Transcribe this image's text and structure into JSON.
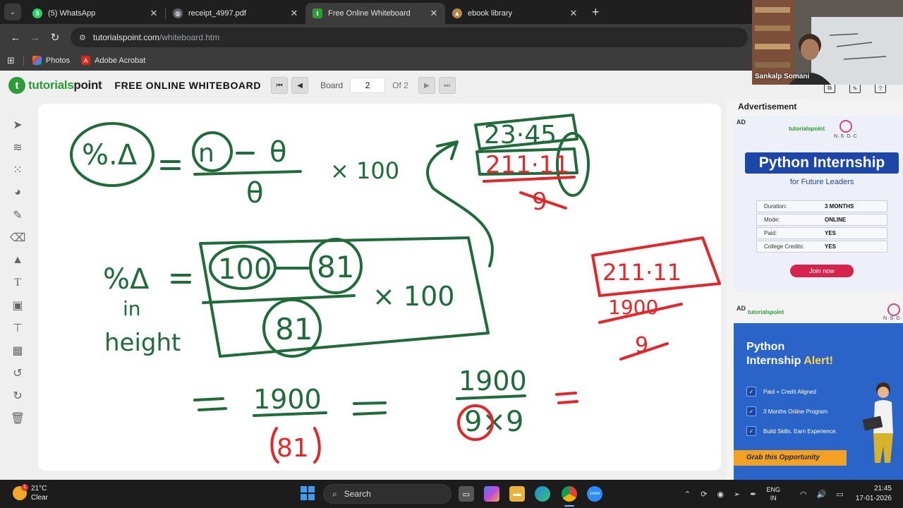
{
  "tabs": [
    {
      "title": "(5) WhatsApp",
      "icon": "whatsapp-icon",
      "color": "#25d366",
      "glyph": "5"
    },
    {
      "title": "receipt_4997.pdf",
      "icon": "globe-icon",
      "color": "#5f6368",
      "glyph": "◍"
    },
    {
      "title": "Free Online Whiteboard",
      "icon": "tutorialspoint-icon",
      "color": "#2c9b38",
      "glyph": "t"
    },
    {
      "title": "ebook library",
      "icon": "book-icon",
      "color": "#b58a45",
      "glyph": "▲"
    }
  ],
  "address": {
    "host": "tutorialspoint.com",
    "path": "/whiteboard.htm"
  },
  "bookmarks": [
    {
      "label": "Photos",
      "icon": "photos-icon"
    },
    {
      "label": "Adobe Acrobat",
      "icon": "acrobat-icon"
    }
  ],
  "site": {
    "logo_part1": "tutorials",
    "logo_part2": "point",
    "title": "FREE ONLINE WHITEBOARD",
    "board_label": "Board",
    "board_value": "2",
    "board_total": "Of 2"
  },
  "ads": {
    "heading": "Advertisement",
    "tag": "AD",
    "brand": "tutorialspoint",
    "nsdc": "N·S·D·C",
    "ad1": {
      "headline": "Python Internship",
      "subline": "for Future Leaders",
      "rows": [
        {
          "k": "Duration:",
          "v": "3 MONTHS"
        },
        {
          "k": "Mode:",
          "v": "ONLINE"
        },
        {
          "k": "Paid:",
          "v": "YES"
        },
        {
          "k": "College Credits:",
          "v": "YES"
        }
      ],
      "button": "Join now"
    },
    "ad2": {
      "headline1": "Python",
      "headline2": "Internship",
      "headline_accent": "Alert!",
      "items": [
        "Paid + Credit Aligned",
        "3 Months Online Program",
        "Build Skills. Earn Experience."
      ],
      "cta": "Grab this Opportunity"
    }
  },
  "webcam": {
    "name": "Sankalp Somani"
  },
  "taskbar": {
    "temp": "21°C",
    "condition": "Clear",
    "weather_badge": "1",
    "search": "Search",
    "lang1": "ENG",
    "lang2": "IN",
    "time": "21:45",
    "date": "17-01-2026"
  },
  "colors": {
    "ink_green": "#1f6b3a",
    "ink_red": "#e3262a",
    "brand_green": "#2c9b38"
  }
}
